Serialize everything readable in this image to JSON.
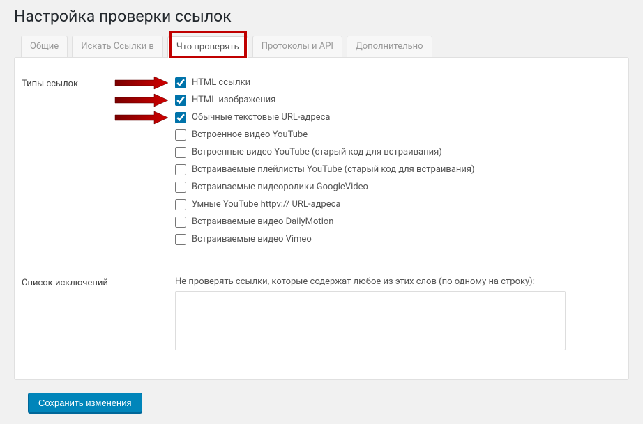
{
  "page": {
    "title": "Настройка проверки ссылок"
  },
  "tabs": [
    {
      "label": "Общие"
    },
    {
      "label": "Искать Ссылки в"
    },
    {
      "label": "Что проверять"
    },
    {
      "label": "Протоколы и API"
    },
    {
      "label": "Дополнительно"
    }
  ],
  "sections": {
    "link_types_label": "Типы ссылок",
    "exclusions_label": "Список исключений",
    "exclusions_hint": "Не проверять ссылки, которые содержат любое из этих слов (по одному на строку):",
    "exclusions_value": ""
  },
  "checkboxes": [
    {
      "label": "HTML ссылки",
      "checked": true,
      "arrow": true
    },
    {
      "label": "HTML изображения",
      "checked": true,
      "arrow": true
    },
    {
      "label": "Обычные текстовые URL-адреса",
      "checked": true,
      "arrow": true
    },
    {
      "label": "Встроенное видео YouTube",
      "checked": false,
      "arrow": false
    },
    {
      "label": "Встроенные видео YouTube (старый код для встраивания)",
      "checked": false,
      "arrow": false
    },
    {
      "label": "Встраиваемые плейлисты YouTube (старый код для встраивания)",
      "checked": false,
      "arrow": false
    },
    {
      "label": "Встраиваемые видеоролики GoogleVideo",
      "checked": false,
      "arrow": false
    },
    {
      "label": "Умные YouTube httpv:// URL-адреса",
      "checked": false,
      "arrow": false
    },
    {
      "label": "Встраиваемые видео DailyMotion",
      "checked": false,
      "arrow": false
    },
    {
      "label": "Встраиваемые видео Vimeo",
      "checked": false,
      "arrow": false
    }
  ],
  "buttons": {
    "save": "Сохранить изменения"
  },
  "colors": {
    "highlight": "#c00000",
    "primary": "#0085ba"
  }
}
